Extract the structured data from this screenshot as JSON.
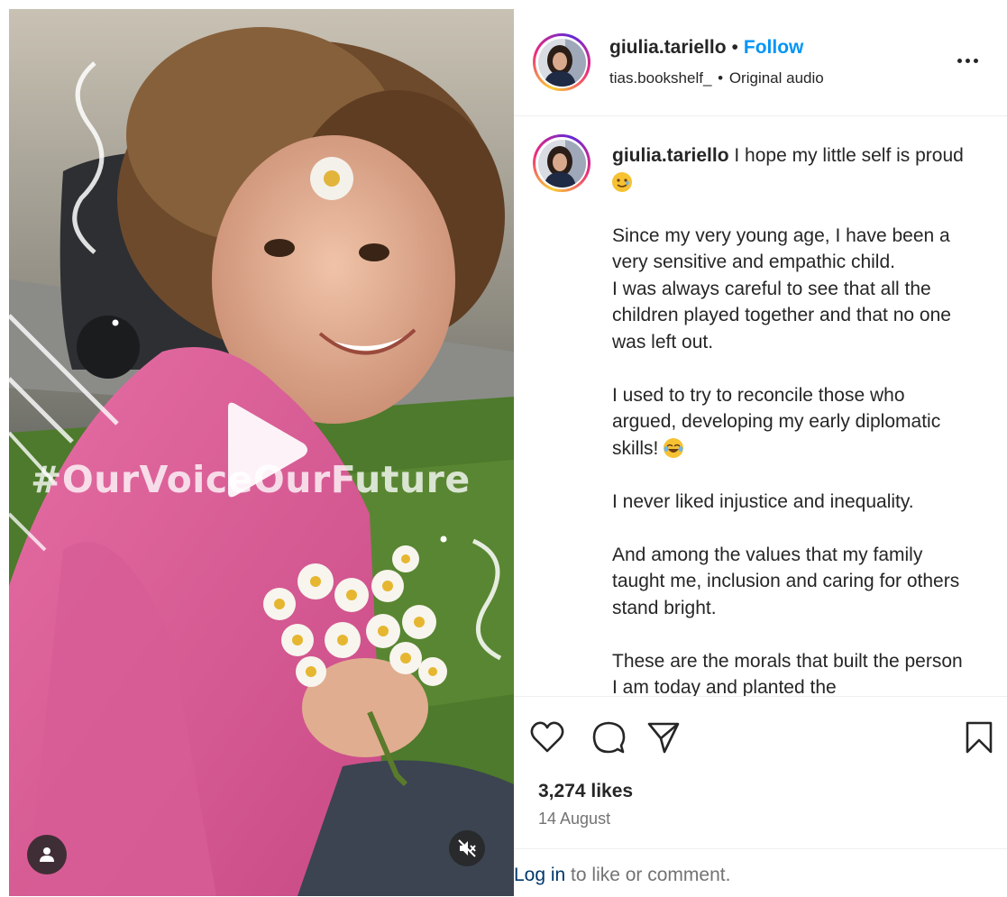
{
  "post": {
    "username": "giulia.tariello",
    "follow_label": "Follow",
    "separator": "•",
    "audio_author": "tias.bookshelf_",
    "audio_title": "Original audio",
    "media_overlay_text": "#OurVoiceOurFuture",
    "caption_paragraphs": [
      "I hope my little self is proud",
      "Since my very young age, I have been a very sensitive and empathic child.\nI was always careful to see that all the children played together and that no one was left out.",
      "I used to try to reconcile those who argued, developing my early diplomatic skills!",
      "I never liked injustice and inequality.",
      "And among the values that my family taught me, inclusion and caring for others stand bright.",
      "These are the morals that built the person I am today and planted the"
    ],
    "likes": "3,274 likes",
    "date": "14 August",
    "login_link": "Log in",
    "login_rest": " to like or comment."
  },
  "icons": {
    "play": "play-icon",
    "user_tag": "person-icon",
    "mute": "speaker-muted-icon",
    "more": "more-horizontal-icon",
    "like": "heart-icon",
    "comment": "speech-bubble-icon",
    "share": "paper-plane-icon",
    "save": "bookmark-icon",
    "emoji_1": "smiling-face-with-tear-emoji",
    "emoji_2": "face-with-tears-of-joy-emoji"
  },
  "colors": {
    "follow": "#0095f6",
    "login_link": "#00376b",
    "secondary_text": "#737373"
  }
}
